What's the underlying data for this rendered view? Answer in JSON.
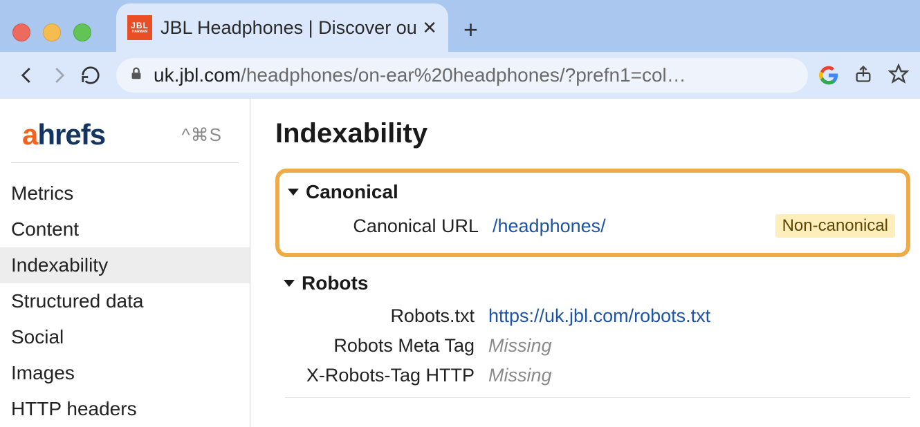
{
  "browser": {
    "tab_title": "JBL Headphones | Discover our",
    "favicon_top": "JBL",
    "favicon_bottom": "HARMAN",
    "url_host": "uk.jbl.com",
    "url_path": "/headphones/on-ear%20headphones/?prefn1=col…"
  },
  "sidebar": {
    "brand_prefix": "a",
    "brand_rest": "hrefs",
    "shortcut": "^⌘S",
    "items": [
      {
        "label": "Metrics"
      },
      {
        "label": "Content"
      },
      {
        "label": "Indexability"
      },
      {
        "label": "Structured data"
      },
      {
        "label": "Social"
      },
      {
        "label": "Images"
      },
      {
        "label": "HTTP headers"
      }
    ],
    "active_index": 2
  },
  "main": {
    "title": "Indexability",
    "canonical": {
      "heading": "Canonical",
      "url_label": "Canonical URL",
      "url_value": "/headphones/",
      "badge": "Non-canonical"
    },
    "robots": {
      "heading": "Robots",
      "rows": [
        {
          "label": "Robots.txt",
          "value": "https://uk.jbl.com/robots.txt",
          "type": "link"
        },
        {
          "label": "Robots Meta Tag",
          "value": "Missing",
          "type": "missing"
        },
        {
          "label": "X-Robots-Tag HTTP",
          "value": "Missing",
          "type": "missing"
        }
      ]
    }
  }
}
